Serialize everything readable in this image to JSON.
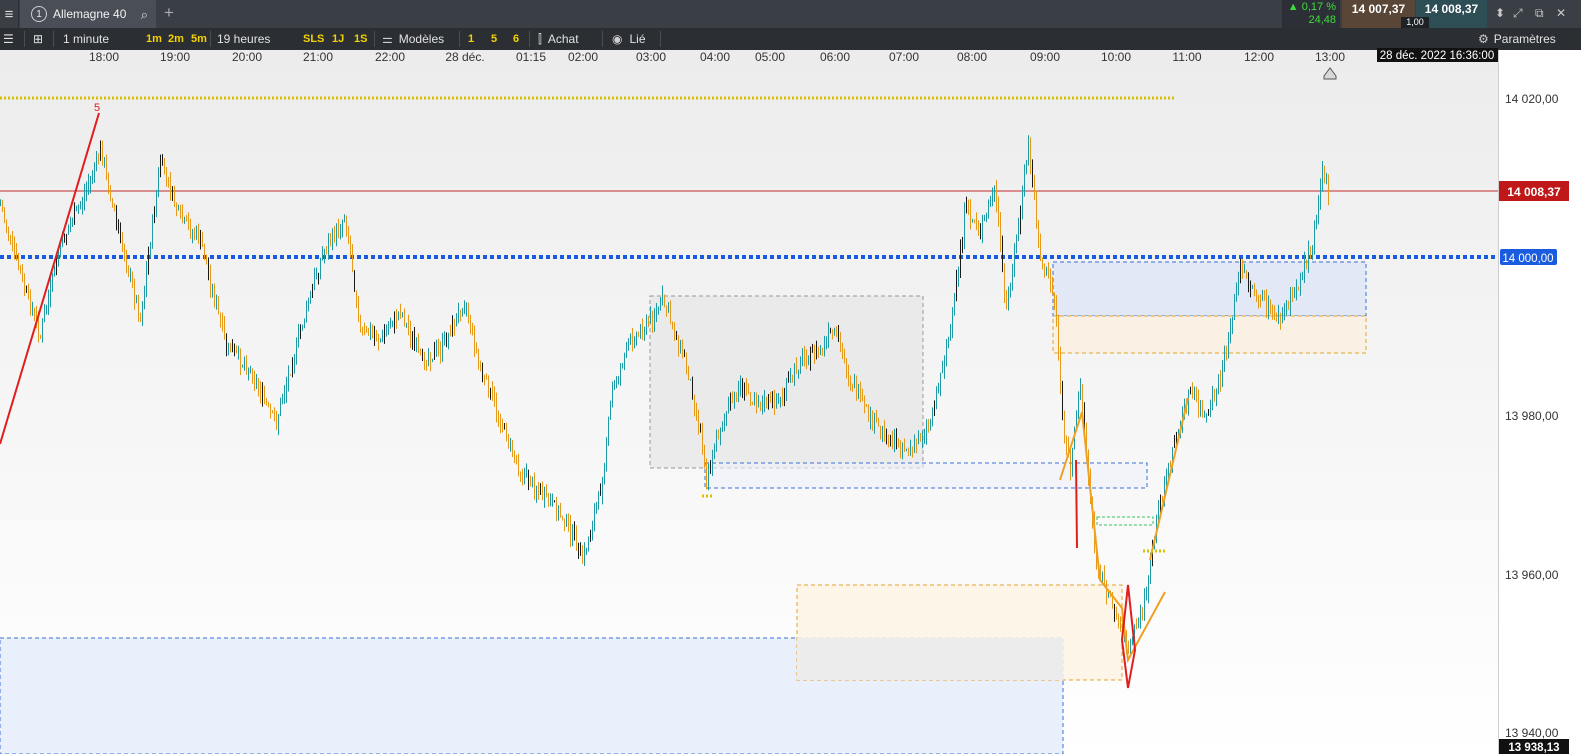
{
  "topbar": {
    "menu_icon": "hamburger-icon",
    "tab": {
      "number": "1",
      "label": "Allemagne 40",
      "search_icon": "search-icon"
    },
    "add_tab_icon": "plus-icon",
    "quote": {
      "change_pct": "▲ 0,17 %",
      "change_pts": "24,48",
      "sell": "14 007,37",
      "buy": "14 008,37",
      "spread": "1,00"
    },
    "window_icons": [
      "expand-icon",
      "popout-icon",
      "close-icon"
    ]
  },
  "toolbar": {
    "timeframe": "1 minute",
    "tf_quick": [
      "1m",
      "2m",
      "5m"
    ],
    "duration": "19 heures",
    "sls": "SLS",
    "period_quick": [
      "1J",
      "1S"
    ],
    "models_label": "Modèles",
    "model_quick": [
      "1",
      "5",
      "6"
    ],
    "buy_label": "Achat",
    "link_label": "Lié",
    "settings_label": "Paramètres"
  },
  "chart": {
    "time_labels": [
      "18:00",
      "19:00",
      "20:00",
      "21:00",
      "22:00",
      "28 déc.",
      "01:15",
      "02:00",
      "03:00",
      "04:00",
      "05:00",
      "06:00",
      "07:00",
      "08:00",
      "09:00",
      "10:00",
      "11:00",
      "12:00",
      "13:00"
    ],
    "cursor_datetime": "28 déc. 2022 16:36:00",
    "price_labels": [
      "14 020,00",
      "13 980,00",
      "13 960,00",
      "13 940,00"
    ],
    "current_price_label": "14 008,37",
    "level_label": "14 000,00",
    "bottom_price_label": "13 938,13",
    "wave_label": "5",
    "colors": {
      "up": "#1e9aa6",
      "down": "#e59a1c",
      "level": "#1a5ce0",
      "current": "#b01c1c",
      "dotted_gold": "#d7c000"
    }
  }
}
